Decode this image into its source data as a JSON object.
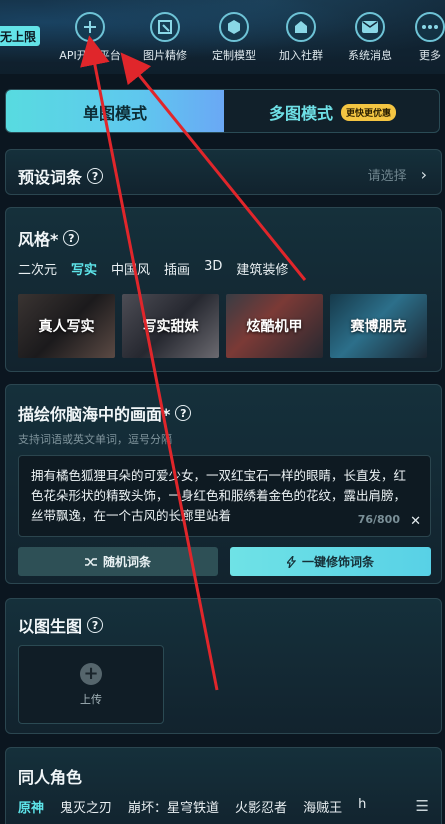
{
  "topnav": {
    "badge": "无上限",
    "items": [
      {
        "label": "API开放平台",
        "icon": "plus-circle-icon"
      },
      {
        "label": "图片精修",
        "icon": "image-edit-icon"
      },
      {
        "label": "定制模型",
        "icon": "cube-icon"
      },
      {
        "label": "加入社群",
        "icon": "community-icon"
      },
      {
        "label": "系统消息",
        "icon": "mail-icon"
      },
      {
        "label": "更多",
        "icon": "more-icon"
      }
    ]
  },
  "tabs": {
    "single": "单图模式",
    "multi": "多图模式",
    "multi_badge": "更快更优惠"
  },
  "preset": {
    "title": "预设词条",
    "help": "?",
    "placeholder": "请选择",
    "chevron": "›"
  },
  "style": {
    "title": "风格*",
    "help": "?",
    "categories": [
      "二次元",
      "写实",
      "中国风",
      "插画",
      "3D",
      "建筑装修"
    ],
    "active_category": "写实",
    "thumbs": [
      "真人写实",
      "写实甜妹",
      "炫酷机甲",
      "赛博朋克"
    ]
  },
  "describe": {
    "title": "描绘你脑海中的画面*",
    "help": "?",
    "hint": "支持词语或英文单词，逗号分隔",
    "text": "拥有橘色狐狸耳朵的可爱少女，一双红宝石一样的眼睛，长直发，红色花朵形状的精致头饰，一身红色和服绣着金色的花纹，露出肩膀，丝带飘逸，在一个古风的长廊里站着",
    "counter": "76/800",
    "clear": "✕",
    "random_btn": "随机词条",
    "enhance_btn": "一键修饰词条"
  },
  "img2img": {
    "title": "以图生图",
    "help": "?",
    "upload_label": "上传",
    "plus": "+"
  },
  "fan": {
    "title": "同人角色",
    "items": [
      "原神",
      "鬼灭之刃",
      "崩坏：星穹铁道",
      "火影忍者",
      "海贼王",
      "h"
    ],
    "menu": "☰"
  },
  "colors": {
    "accent": "#5ee5ea",
    "arrow": "#e0262b"
  }
}
